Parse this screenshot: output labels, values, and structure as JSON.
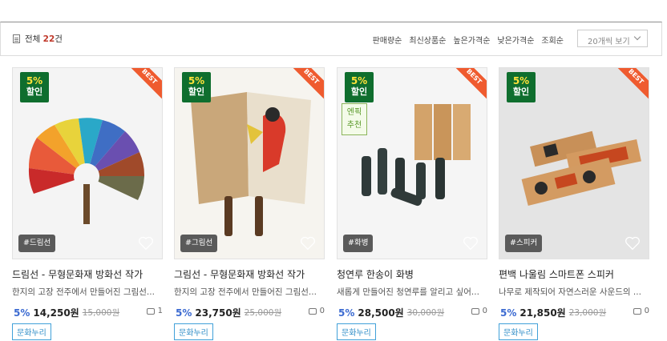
{
  "toolbar": {
    "total_prefix": "전체 ",
    "total_count": "22",
    "total_suffix": "건",
    "sorts": [
      "판매량순",
      "최신상품순",
      "높은가격순",
      "낮은가격순",
      "조회순"
    ],
    "per_page": "20개씩 보기"
  },
  "products": [
    {
      "discount_pct": "5%",
      "discount_label": "할인",
      "best": "BEST",
      "tag": "#드림선",
      "title": "드림선 - 무형문화재 방화선 작가",
      "desc": "한지의 고장 전주에서 만들어진 그림선...",
      "pct": "5%",
      "price": "14,250원",
      "orig": "15,000원",
      "comments": "1",
      "badge": "문화누리"
    },
    {
      "discount_pct": "5%",
      "discount_label": "할인",
      "best": "BEST",
      "tag": "#그림선",
      "title": "그림선 - 무형문화재 방화선 작가",
      "desc": "한지의 고장 전주에서 만들어진 그림선...",
      "pct": "5%",
      "price": "23,750원",
      "orig": "25,000원",
      "comments": "0",
      "badge": "문화누리"
    },
    {
      "discount_pct": "5%",
      "discount_label": "할인",
      "best": "BEST",
      "tag": "#화병",
      "title": "청연루 한송이 화병",
      "desc": "새롭게 만들어진 청연루를 알리고 싶어...",
      "pct": "5%",
      "price": "28,500원",
      "orig": "30,000원",
      "comments": "0",
      "badge": "문화누리",
      "sticker": [
        "엔픽",
        "추천"
      ]
    },
    {
      "discount_pct": "5%",
      "discount_label": "할인",
      "best": "BEST",
      "tag": "#스피커",
      "title": "편백 나울림 스마트폰 스피커",
      "desc": "나무로 제작되어 자연스러운 사운드의 ...",
      "pct": "5%",
      "price": "21,850원",
      "orig": "23,000원",
      "comments": "0",
      "badge": "문화누리"
    }
  ]
}
